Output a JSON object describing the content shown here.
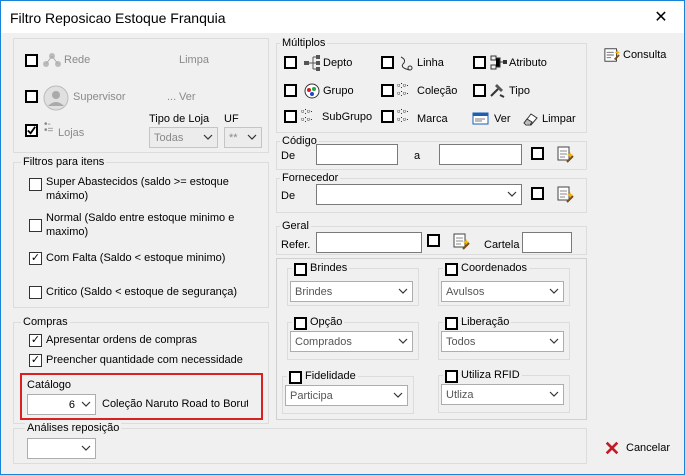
{
  "window": {
    "title": "Filtro Reposicao Estoque Franquia",
    "close_glyph": "✕"
  },
  "top_left": {
    "rede": "Rede",
    "limpa": "Limpa",
    "supervisor": "Supervisor",
    "ver": "Ver",
    "lojas": "Lojas",
    "tipo_loja_label": "Tipo de Loja",
    "tipo_loja_value": "Todas",
    "uf_label": "UF",
    "uf_value": "**"
  },
  "filtros": {
    "title": "Filtros para itens",
    "super_1": "Super Abastecidos  (saldo >= estoque",
    "super_2": "máximo)",
    "normal_1": "Normal (Saldo entre estoque minimo e",
    "normal_2": "maximo)",
    "com_falta": "Com Falta (Saldo < estoque minimo)",
    "critico": "Critico (Saldo < estoque de segurança)"
  },
  "compras": {
    "title": "Compras",
    "ordens": "Apresentar ordens de compras",
    "preencher": "Preencher quantidade com necessidade"
  },
  "catalogo": {
    "title": "Catálogo",
    "number": "6",
    "name": "Coleção Naruto Road to Boruto"
  },
  "analises": {
    "title": "Análises reposição"
  },
  "multiplos": {
    "title": "Múltiplos",
    "depto": "Depto",
    "linha": "Linha",
    "atributo": "Atributo",
    "grupo": "Grupo",
    "colecao": "Coleção",
    "tipo": "Tipo",
    "subgrupo": "SubGrupo",
    "marca": "Marca",
    "ver": "Ver",
    "limpar": "Limpar"
  },
  "codigo": {
    "title": "Código",
    "de": "De",
    "a": "a"
  },
  "fornecedor": {
    "title": "Fornecedor",
    "de": "De"
  },
  "geral": {
    "title": "Geral",
    "refer": "Refer.",
    "cartela": "Cartela"
  },
  "options": {
    "brindes_label": "Brindes",
    "brindes_value": "Brindes",
    "coordenados_label": "Coordenados",
    "coordenados_value": "Avulsos",
    "opcao_label": "Opção",
    "opcao_value": "Comprados",
    "liberacao_label": "Liberação",
    "liberacao_value": "Todos",
    "fidelidade_label": "Fidelidade",
    "fidelidade_value": "Participa",
    "rfid_label": "Utiliza RFID",
    "rfid_value": "Utliza"
  },
  "buttons": {
    "consulta": "Consulta",
    "cancelar": "Cancelar"
  },
  "colors": {
    "accent_red": "#d92121",
    "window_border": "#1883d7",
    "icon_blue": "#1a5fb4"
  }
}
